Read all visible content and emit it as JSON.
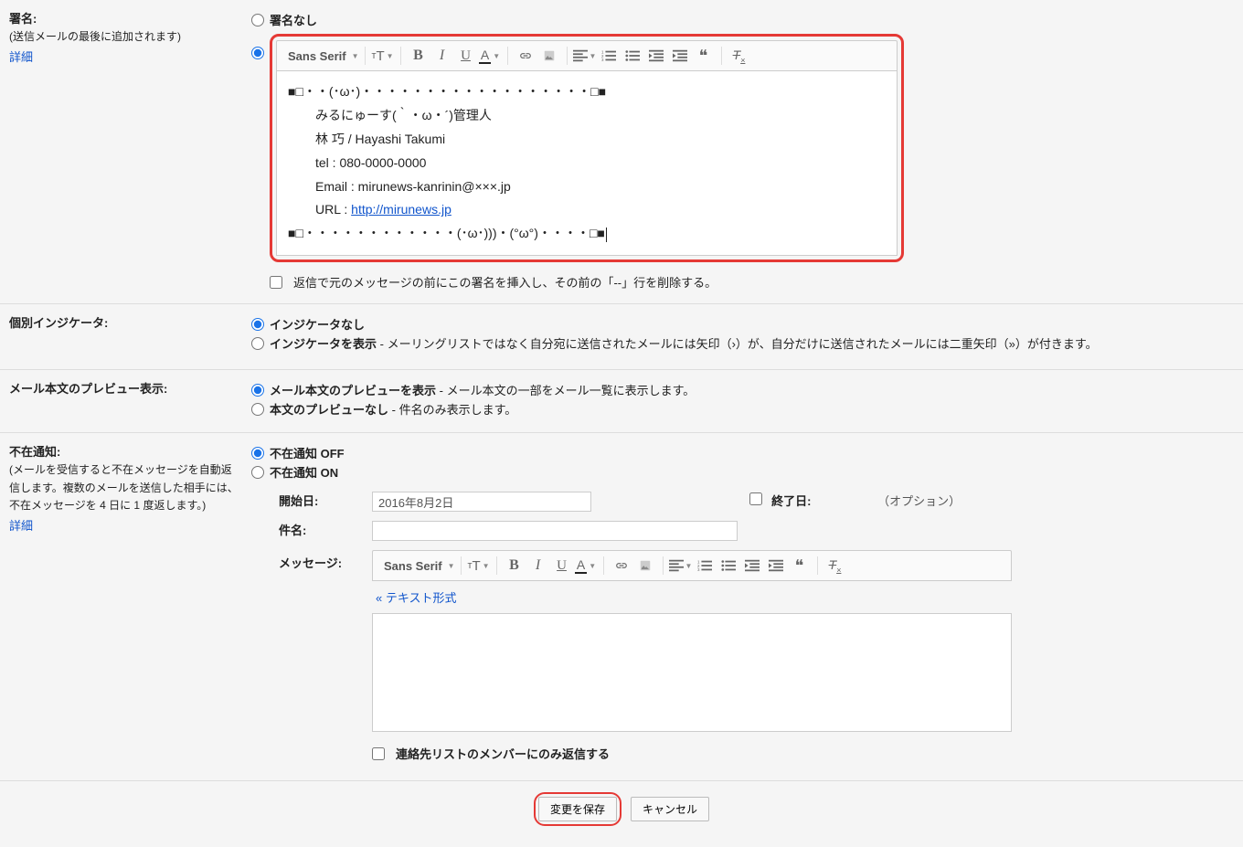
{
  "signature": {
    "title": "署名:",
    "sub": "(送信メールの最後に追加されます)",
    "learn_more": "詳細",
    "opt_none": "署名なし",
    "editor": {
      "font_label": "Sans Serif",
      "line1": "■□・・(･ω･)・・・・・・・・・・・・・・・・・・□■",
      "line2": "みるにゅーす(｀・ω・´)管理人",
      "line3": "林 巧 / Hayashi Takumi",
      "line4": "tel : 080-0000-0000",
      "line5": "Email : mirunews-kanrinin@×××.jp",
      "line6_prefix": "URL : ",
      "line6_link": "http://mirunews.jp",
      "line7": "■□・・・・・・・・・・・・(･ω･)))・(°ω°)・・・・□■"
    },
    "insert_before_label": "返信で元のメッセージの前にこの署名を挿入し、その前の「--」行を削除する。"
  },
  "indicators": {
    "title": "個別インジケータ:",
    "opt_none": "インジケータなし",
    "opt_show_bold": "インジケータを表示",
    "opt_show_desc": " - メーリングリストではなく自分宛に送信されたメールには矢印（›）が、自分だけに送信されたメールには二重矢印（»）が付きます。"
  },
  "snippets": {
    "title": "メール本文のプレビュー表示:",
    "opt_show_bold": "メール本文のプレビューを表示",
    "opt_show_desc": " - メール本文の一部をメール一覧に表示します。",
    "opt_hide_bold": "本文のプレビューなし",
    "opt_hide_desc": " - 件名のみ表示します。"
  },
  "vacation": {
    "title": "不在通知:",
    "sub": "(メールを受信すると不在メッセージを自動返信します。複数のメールを送信した相手には、不在メッセージを 4 日に 1 度返します。)",
    "learn_more": "詳細",
    "opt_off": "不在通知 OFF",
    "opt_on": "不在通知 ON",
    "start_label": "開始日:",
    "start_value": "2016年8月2日",
    "end_label": "終了日:",
    "end_placeholder": "（オプション）",
    "subject_label": "件名:",
    "message_label": "メッセージ:",
    "font_label": "Sans Serif",
    "plain_text": "« テキスト形式",
    "contacts_only": "連絡先リストのメンバーにのみ返信する"
  },
  "footer": {
    "save": "変更を保存",
    "cancel": "キャンセル"
  }
}
